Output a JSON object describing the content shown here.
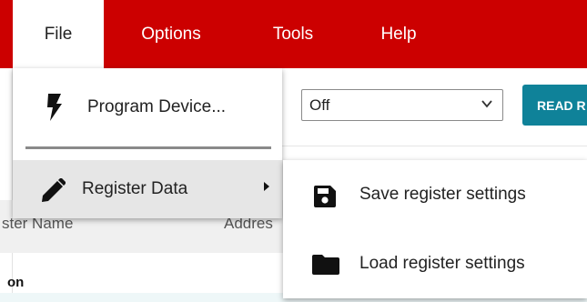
{
  "menubar": {
    "items": [
      {
        "label": "File",
        "active": true
      },
      {
        "label": "Options",
        "active": false
      },
      {
        "label": "Tools",
        "active": false
      },
      {
        "label": "Help",
        "active": false
      }
    ]
  },
  "file_menu": {
    "items": [
      {
        "label": "Program Device...",
        "icon": "lightning-bolt-icon"
      },
      {
        "label": "Register Data",
        "icon": "pencil-icon",
        "has_submenu": true
      }
    ]
  },
  "submenu": {
    "items": [
      {
        "label": "Save register settings",
        "icon": "floppy-disk-icon"
      },
      {
        "label": "Load register settings",
        "icon": "folder-icon"
      }
    ]
  },
  "background": {
    "select_value": "Off",
    "read_button_label": "READ R",
    "column_register_name": "ster Name",
    "column_address": "Addres",
    "section_label": "on"
  },
  "colors": {
    "menubar": "#cc0000",
    "read_button": "#0f8299",
    "menu_hover": "#e6e6e6"
  }
}
